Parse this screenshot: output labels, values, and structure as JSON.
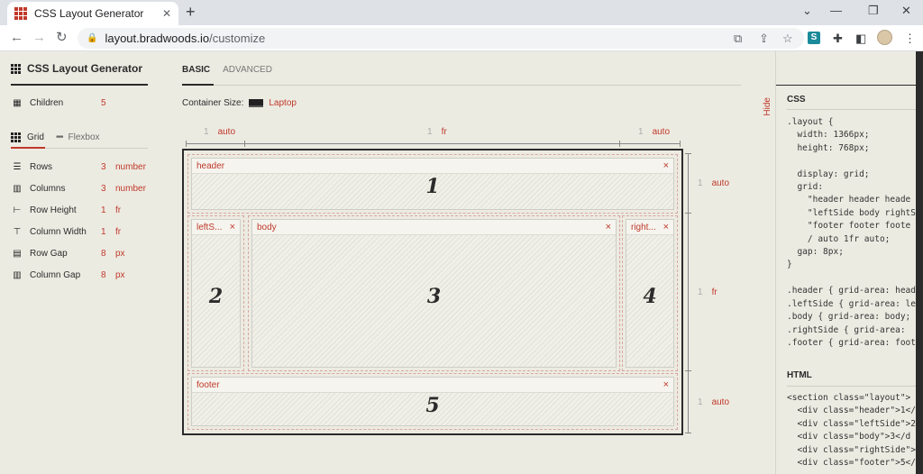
{
  "browser": {
    "tab_title": "CSS Layout Generator",
    "url_host": "layout.bradwoods.io",
    "url_path": "/customize",
    "extension_label": "S"
  },
  "sidebar": {
    "app_title": "CSS Layout Generator",
    "children": {
      "label": "Children",
      "value": "5"
    },
    "modes": [
      {
        "label": "Grid",
        "active": true
      },
      {
        "label": "Flexbox",
        "active": false
      }
    ],
    "props": [
      {
        "icon": "rows-icon",
        "label": "Rows",
        "value": "3",
        "unit": "number"
      },
      {
        "icon": "columns-icon",
        "label": "Columns",
        "value": "3",
        "unit": "number"
      },
      {
        "icon": "row-height-icon",
        "label": "Row Height",
        "value": "1",
        "unit": "fr"
      },
      {
        "icon": "column-width-icon",
        "label": "Column Width",
        "value": "1",
        "unit": "fr"
      },
      {
        "icon": "row-gap-icon",
        "label": "Row Gap",
        "value": "8",
        "unit": "px"
      },
      {
        "icon": "column-gap-icon",
        "label": "Column Gap",
        "value": "8",
        "unit": "px"
      }
    ]
  },
  "main": {
    "tabs": [
      {
        "label": "BASIC",
        "active": true
      },
      {
        "label": "ADVANCED",
        "active": false
      }
    ],
    "container_size_label": "Container Size:",
    "container_size_value": "Laptop",
    "column_tracks": [
      {
        "num": "1",
        "unit": "auto"
      },
      {
        "num": "1",
        "unit": "fr"
      },
      {
        "num": "1",
        "unit": "auto"
      }
    ],
    "row_tracks": [
      {
        "num": "1",
        "unit": "auto"
      },
      {
        "num": "1",
        "unit": "fr"
      },
      {
        "num": "1",
        "unit": "auto"
      }
    ],
    "areas": [
      {
        "name": "header",
        "number": "1"
      },
      {
        "name": "leftS...",
        "number": "2"
      },
      {
        "name": "body",
        "number": "3"
      },
      {
        "name": "right...",
        "number": "4"
      },
      {
        "name": "footer",
        "number": "5"
      }
    ],
    "close_glyph": "×",
    "hide_label": "Hide"
  },
  "code_panel": {
    "css_title": "CSS",
    "html_title": "HTML",
    "css_lines": [
      ".layout {",
      "  width: 1366px;",
      "  height: 768px;",
      "",
      "  display: grid;",
      "  grid:",
      "    \"header header heade",
      "    \"leftSide body rightS",
      "    \"footer footer foote",
      "    / auto 1fr auto;",
      "  gap: 8px;",
      "}",
      "",
      ".header { grid-area: head",
      ".leftSide { grid-area: le",
      ".body { grid-area: body;",
      ".rightSide { grid-area:",
      ".footer { grid-area: foot"
    ],
    "html_lines": [
      "<section class=\"layout\">",
      "  <div class=\"header\">1</",
      "  <div class=\"leftSide\">2",
      "  <div class=\"body\">3</d",
      "  <div class=\"rightSide\">",
      "  <div class=\"footer\">5</"
    ]
  }
}
